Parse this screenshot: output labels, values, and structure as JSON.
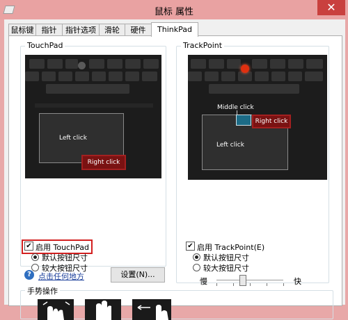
{
  "window": {
    "title": "鼠标 属性",
    "close_glyph": "✕"
  },
  "tabs": [
    {
      "label": "鼠标键"
    },
    {
      "label": "指针"
    },
    {
      "label": "指针选项"
    },
    {
      "label": "滑轮"
    },
    {
      "label": "硬件"
    },
    {
      "label": "ThinkPad",
      "active": true
    }
  ],
  "touchpad": {
    "group_label": "TouchPad",
    "left_click": "Left click",
    "right_click": "Right click",
    "enable_label": "启用 TouchPad",
    "enable_checked": true,
    "size_options": [
      {
        "label": "默认按钮尺寸",
        "selected": true
      },
      {
        "label": "较大按钮尺寸",
        "selected": false
      }
    ],
    "help_link": "点击任何地方",
    "settings_button": "设置(N)..."
  },
  "trackpoint": {
    "group_label": "TrackPoint",
    "middle_click": "Middle click",
    "right_click": "Right click",
    "left_click": "Left click",
    "enable_label": "启用 TrackPoint(E)",
    "enable_checked": true,
    "size_options": [
      {
        "label": "默认按钮尺寸",
        "selected": true
      },
      {
        "label": "较大按钮尺寸",
        "selected": false
      }
    ],
    "speed_slow": "慢",
    "speed_fast": "快",
    "speed_value": 0.4
  },
  "gestures": {
    "group_label": "手势操作"
  },
  "colors": {
    "highlight": "#d32020",
    "title_bar": "#e9a2a2",
    "right_click": "#7a1212",
    "trackpoint": "#e03010"
  }
}
